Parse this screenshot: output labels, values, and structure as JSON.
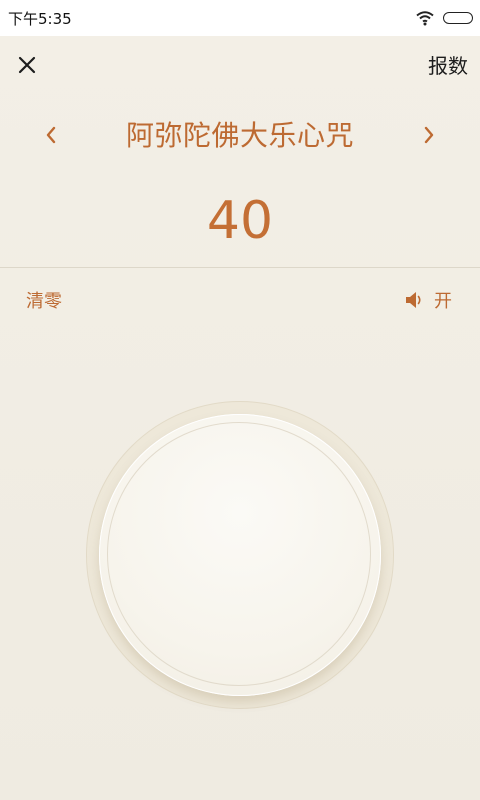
{
  "status_bar": {
    "time": "下午5:35"
  },
  "header": {
    "close_icon": "close-icon",
    "report_label": "报数"
  },
  "mantra": {
    "prev_icon": "chevron-left-icon",
    "title": "阿弥陀佛大乐心咒",
    "next_icon": "chevron-right-icon"
  },
  "counter": {
    "value": "40"
  },
  "controls": {
    "reset_label": "清零",
    "sound_icon": "speaker-icon",
    "sound_state": "开"
  },
  "colors": {
    "accent": "#bd6a32",
    "background": "#f2eee4"
  }
}
